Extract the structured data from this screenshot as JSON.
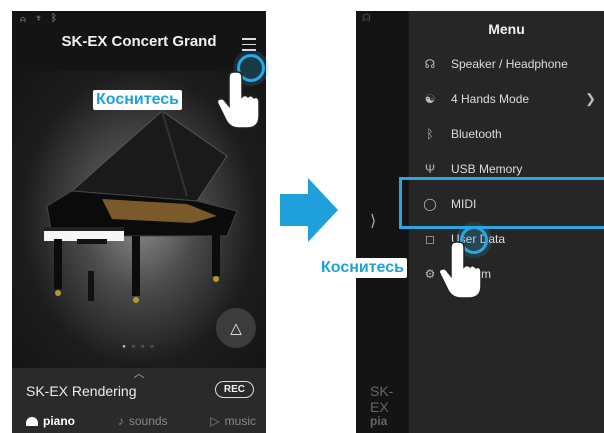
{
  "left_screen": {
    "title": "SK-EX Concert Grand",
    "status_icons": "☊ ♆ ᛒ",
    "page_dots": "● ○ ○ ○",
    "rendering_label": "SK-EX Rendering",
    "rec_label": "REC",
    "tabs": [
      {
        "label": "piano",
        "icon": "piano-icon"
      },
      {
        "label": "sounds",
        "icon": "note-icon"
      },
      {
        "label": "music",
        "icon": "play-icon"
      }
    ],
    "callout": "Коснитесь"
  },
  "right_screen": {
    "menu_title": "Menu",
    "items": [
      {
        "label": "Speaker / Headphone",
        "icon": "headphone-icon"
      },
      {
        "label": "4 Hands Mode",
        "icon": "two-people-icon",
        "has_submenu": true
      },
      {
        "label": "Bluetooth",
        "icon": "bluetooth-icon"
      },
      {
        "label": "USB Memory",
        "icon": "usb-icon"
      },
      {
        "label": "MIDI",
        "icon": "midi-icon"
      },
      {
        "label": "User Data",
        "icon": "user-icon"
      },
      {
        "label": "System",
        "icon": "system-icon"
      }
    ],
    "background_labels": [
      "SK-EX",
      "pia"
    ],
    "callout": "Коснитесь"
  },
  "colors": {
    "accent": "#2aa6e0",
    "background": "#141414",
    "menu_bg": "#262626"
  }
}
